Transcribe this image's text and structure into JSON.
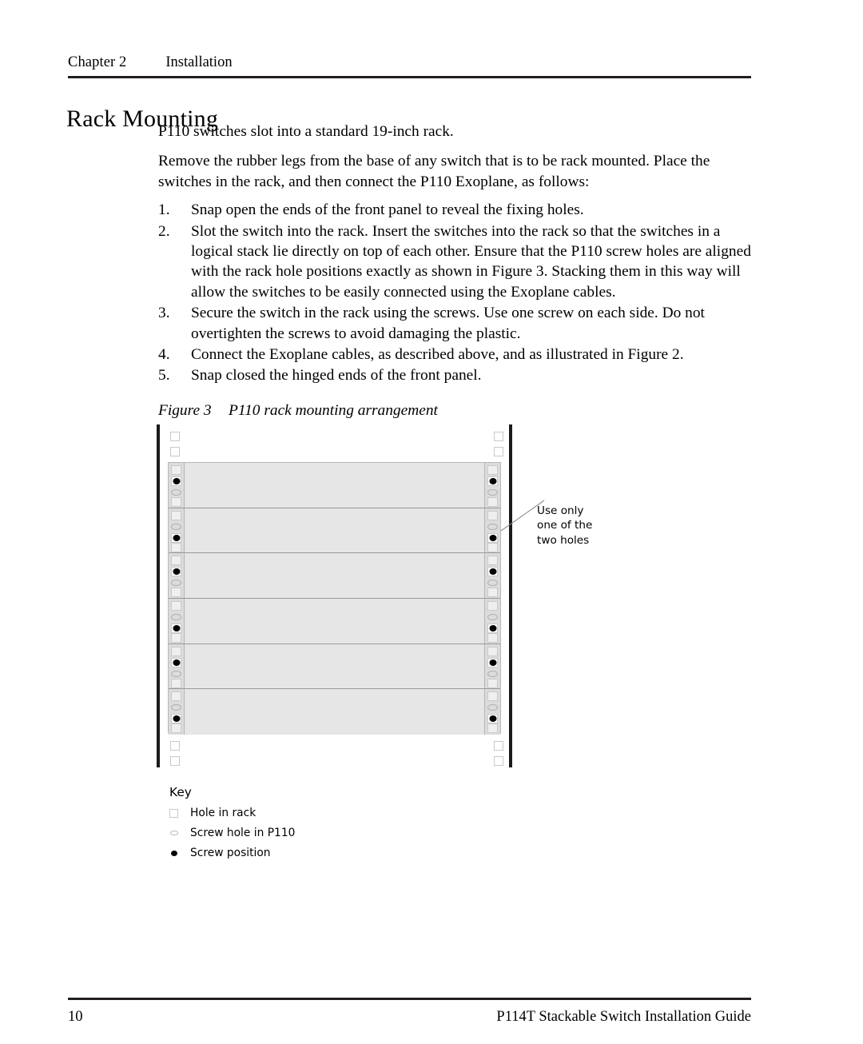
{
  "header": {
    "chapter": "Chapter 2",
    "topic": "Installation"
  },
  "heading": "Rack Mounting",
  "body": {
    "paragraphs": [
      "P110 switches slot into a standard 19-inch rack.",
      "Remove the rubber legs from the base of any switch that is to be rack mounted. Place the switches in the rack, and then connect the P110 Exoplane, as follows:"
    ],
    "steps": [
      {
        "num": "1.",
        "text": "Snap open the ends of the front panel to reveal the fixing holes."
      },
      {
        "num": "2.",
        "text": "Slot the switch into the rack. Insert the switches into the rack so that the switches in a logical stack lie directly on top of each other. Ensure that the P110 screw holes are aligned with the rack hole positions exactly as shown in Figure 3. Stacking them in this way will allow the switches to be easily connected using the Exoplane cables."
      },
      {
        "num": "3.",
        "text": "Secure the switch in the rack using the screws. Use one screw on each side. Do not overtighten the screws to avoid damaging the plastic."
      },
      {
        "num": "4.",
        "text": "Connect the Exoplane cables, as described above, and as illustrated in Figure 2."
      },
      {
        "num": "5.",
        "text": "Snap closed the hinged ends of the front panel."
      }
    ]
  },
  "figure": {
    "label": "Figure 3",
    "title": "P110 rack mounting arrangement",
    "callout": "Use only\none of the\ntwo holes",
    "units_count": 6,
    "holes_per_unit": 4,
    "top_rack_holes": 2,
    "bottom_rack_holes": 2,
    "colors": {
      "rail": "#1a1a1a",
      "unit_fill": "#e6e6e6",
      "ear_fill": "#dcdcdc",
      "hole_outline": "#c9c9c9",
      "screw": "#000000"
    },
    "unit_screw_slot": [
      1,
      2,
      1,
      2,
      1,
      2
    ]
  },
  "key": {
    "title": "Key",
    "items": [
      {
        "symbol": "rack-hole-square-icon",
        "label": "Hole in rack"
      },
      {
        "symbol": "screw-hole-ellipse-icon",
        "label": "Screw hole in P110"
      },
      {
        "symbol": "screw-position-dot-icon",
        "label": "Screw position"
      }
    ]
  },
  "footer": {
    "page_number": "10",
    "guide_title": "P114T Stackable Switch Installation Guide"
  }
}
